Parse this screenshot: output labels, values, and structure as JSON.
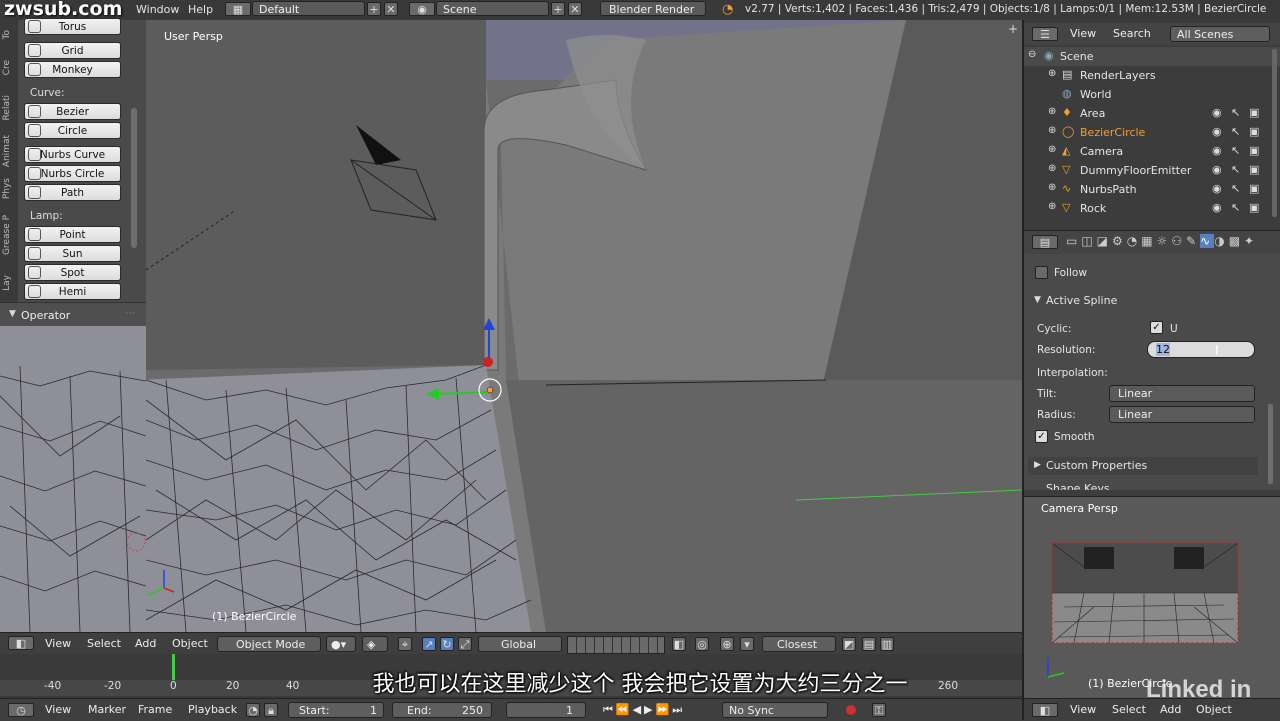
{
  "watermark": "zwsub.com",
  "topbar": {
    "menus": [
      "Window",
      "Help"
    ],
    "layout": "Default",
    "scene": "Scene",
    "engine": "Blender Render",
    "stats": "v2.77 | Verts:1,402 | Faces:1,436 | Tris:2,479 | Objects:1/8 | Lamps:0/1 | Mem:12.53M | BezierCircle"
  },
  "toolshelf": {
    "tabs": [
      "To",
      "Cre",
      "Relati",
      "Animat",
      "Phys",
      "Grease P",
      "Lay"
    ],
    "mesh_buttons": [
      "Torus",
      "Grid",
      "Monkey"
    ],
    "curve_label": "Curve:",
    "curve_buttons": [
      "Bezier",
      "Circle",
      "Nurbs Curve",
      "Nurbs Circle",
      "Path"
    ],
    "lamp_label": "Lamp:",
    "lamp_buttons": [
      "Point",
      "Sun",
      "Spot",
      "Hemi"
    ],
    "operator": "Operator"
  },
  "viewport": {
    "view_label": "User Persp",
    "object_label": "(1) BezierCircle"
  },
  "viewport_header": {
    "menus": [
      "View",
      "Select",
      "Add",
      "Object"
    ],
    "mode": "Object Mode",
    "orientation": "Global",
    "snap": "Closest"
  },
  "timeline": {
    "ticks": [
      "-40",
      "-20",
      "0",
      "20",
      "40",
      "260"
    ],
    "menus": [
      "View",
      "Marker",
      "Frame",
      "Playback"
    ],
    "start_label": "Start:",
    "start_value": "1",
    "end_label": "End:",
    "end_value": "250",
    "current": "1",
    "sync": "No Sync"
  },
  "outliner": {
    "menus": [
      "View",
      "Search"
    ],
    "filter": "All Scenes",
    "items": [
      "Scene",
      "RenderLayers",
      "World",
      "Area",
      "BezierCircle",
      "Camera",
      "DummyFloorEmitter",
      "NurbsPath",
      "Rock"
    ]
  },
  "properties": {
    "follow": "Follow",
    "active_spline": "Active Spline",
    "cyclic_label": "Cyclic:",
    "cyclic_u": "U",
    "resolution_label": "Resolution:",
    "resolution_value": "12",
    "interpolation_label": "Interpolation:",
    "tilt_label": "Tilt:",
    "tilt_value": "Linear",
    "radius_label": "Radius:",
    "radius_value": "Linear",
    "smooth": "Smooth",
    "custom_props": "Custom Properties",
    "shape_keys": "Shape Keys"
  },
  "camera_view": {
    "label": "Camera Persp",
    "object_label": "(1) BezierCircle",
    "menus": [
      "View",
      "Select",
      "Add",
      "Object"
    ]
  },
  "subtitle": "我也可以在这里减少这个  我会把它设置为大约三分之一",
  "linkedin": "Linked in",
  "colors": {
    "accent": "#5680c2",
    "selected_text": "#f0a030",
    "button_bg": "#e6e6e6"
  }
}
